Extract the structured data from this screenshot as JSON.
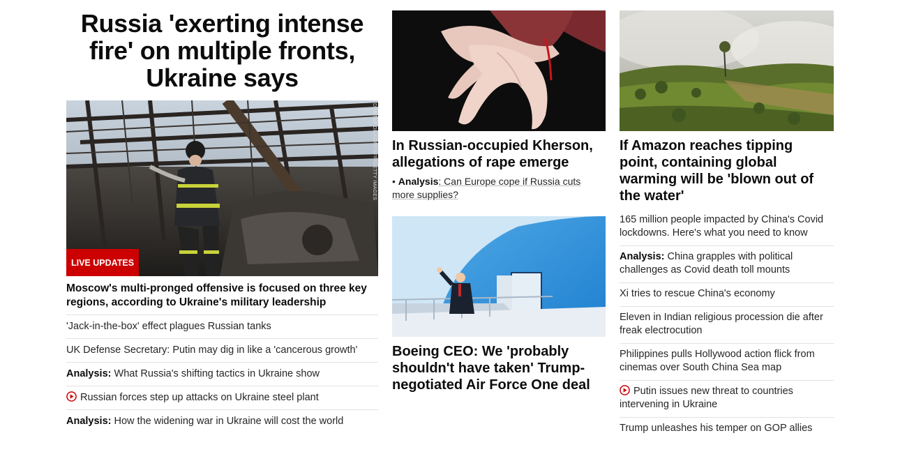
{
  "colors": {
    "accent_red": "#cc0000",
    "divider": "#e2e2e2",
    "text": "#0c0c0c"
  },
  "column1": {
    "headline": "Russia 'exerting intense fire' on multiple fronts, Ukraine says",
    "image_credit": "DIMITAR DILKOFF/AFP/GETTY IMAGES",
    "badge": "LIVE UPDATES",
    "subheadline": "Moscow's multi-pronged offensive is focused on three key regions, according to Ukraine's military leadership",
    "links": [
      {
        "prefix": "",
        "icon": "",
        "text": "'Jack-in-the-box' effect plagues Russian tanks"
      },
      {
        "prefix": "",
        "icon": "",
        "text": "UK Defense Secretary: Putin may dig in like a 'cancerous growth'"
      },
      {
        "prefix": "Analysis:",
        "icon": "",
        "text": "What Russia's shifting tactics in Ukraine show"
      },
      {
        "prefix": "",
        "icon": "play-icon",
        "text": "Russian forces step up attacks on Ukraine steel plant"
      },
      {
        "prefix": "Analysis:",
        "icon": "",
        "text": "How the widening war in Ukraine will cost the world"
      }
    ]
  },
  "column2": {
    "card1": {
      "headline": "In Russian-occupied Kherson, allegations of rape emerge",
      "bullet": "•",
      "analysis_prefix": "Analysis",
      "analysis_text": ": Can Europe cope if Russia cuts more supplies?"
    },
    "card2": {
      "headline": "Boeing CEO: We 'probably shouldn't have taken' Trump-negotiated Air Force One deal"
    }
  },
  "column3": {
    "card": {
      "headline": "If Amazon reaches tipping point, containing global warming will be 'blown out of the water'"
    },
    "links": [
      {
        "prefix": "",
        "icon": "",
        "text": "165 million people impacted by China's Covid lockdowns. Here's what you need to know"
      },
      {
        "prefix": "Analysis:",
        "icon": "",
        "text": "China grapples with political challenges as Covid death toll mounts"
      },
      {
        "prefix": "",
        "icon": "",
        "text": "Xi tries to rescue China's economy"
      },
      {
        "prefix": "",
        "icon": "",
        "text": "Eleven in Indian religious procession die after freak electrocution"
      },
      {
        "prefix": "",
        "icon": "",
        "text": "Philippines pulls Hollywood action flick from cinemas over South China Sea map"
      },
      {
        "prefix": "",
        "icon": "play-icon",
        "text": "Putin issues new threat to countries intervening in Ukraine"
      },
      {
        "prefix": "",
        "icon": "",
        "text": "Trump unleashes his temper on GOP allies"
      }
    ]
  }
}
